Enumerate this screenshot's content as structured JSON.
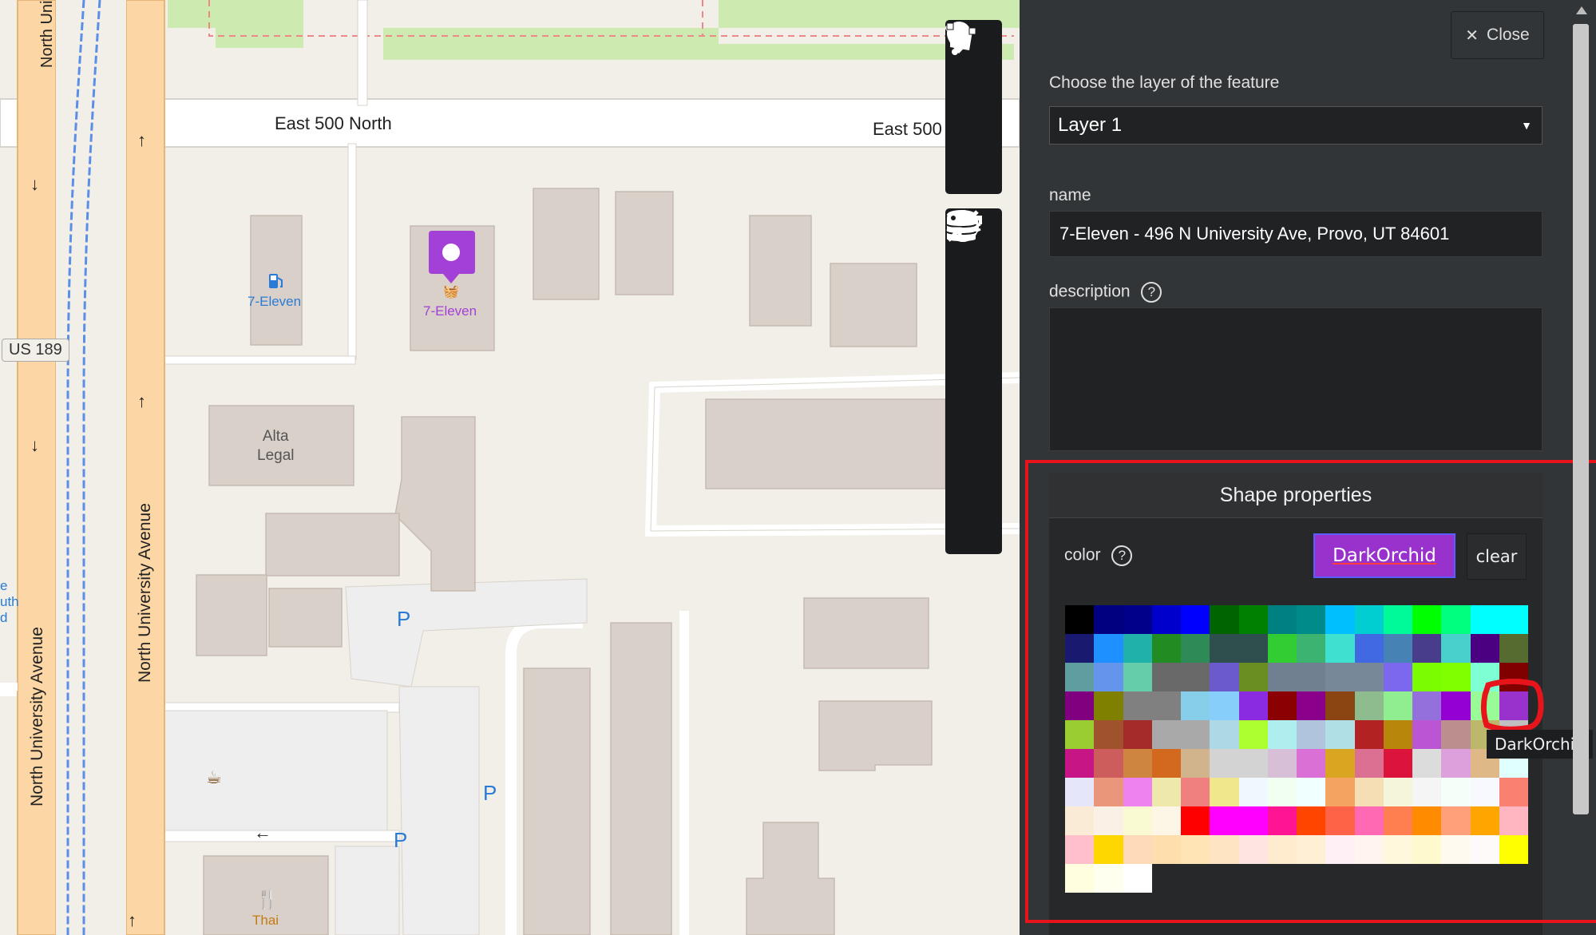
{
  "map": {
    "streets": {
      "east_500_north": "East 500 North",
      "east_500_right": "East 500",
      "north_univ_top": "North Unive",
      "north_univ_left": "North University Avenue",
      "north_univ_right": "North University Avenue",
      "us189": "US 189"
    },
    "pois": {
      "seven_eleven_1": "7-Eleven",
      "seven_eleven_2": "7-Eleven",
      "alta_legal": "Alta\nLegal",
      "thai": "Thai",
      "parking": "P",
      "side_text": "e\nuth\nd"
    },
    "marker_color": "#a340d8"
  },
  "toolbar": {
    "group1": [
      "marker-icon",
      "polyline-icon",
      "polygon-icon"
    ],
    "group2": [
      "upload-icon",
      "gear-icon",
      "layers-icon",
      "database-icon",
      "shrink-icon",
      "key-icon"
    ]
  },
  "panel": {
    "close_label": "Close",
    "layer_label": "Choose the layer of the feature",
    "layer_value": "Layer 1",
    "name_label": "name",
    "name_value": "7-Eleven - 496 N University Ave, Provo, UT 84601",
    "description_label": "description",
    "help_glyph": "?",
    "shape_title": "Shape properties",
    "color_label": "color",
    "color_value": "DarkOrchid",
    "color_hex": "#9932cc",
    "clear_label": "clear",
    "tooltip": "DarkOrchid",
    "palette": [
      "#000000",
      "#000080",
      "#00008b",
      "#0000cd",
      "#0000ff",
      "#006400",
      "#008000",
      "#008080",
      "#008b8b",
      "#00bfff",
      "#00ced1",
      "#00fa9a",
      "#00ff00",
      "#00ff7f",
      "#00ffff",
      "#00ffff",
      "#191970",
      "#1e90ff",
      "#20b2aa",
      "#228b22",
      "#2e8b57",
      "#2f4f4f",
      "#2f4f4f",
      "#32cd32",
      "#3cb371",
      "#40e0d0",
      "#4169e1",
      "#4682b4",
      "#483d8b",
      "#48d1cc",
      "#4b0082",
      "#556b2f",
      "#5f9ea0",
      "#6495ed",
      "#66cdaa",
      "#696969",
      "#696969",
      "#6a5acd",
      "#6b8e23",
      "#708090",
      "#708090",
      "#778899",
      "#778899",
      "#7b68ee",
      "#7cfc00",
      "#7fff00",
      "#7fffd4",
      "#800000",
      "#800080",
      "#808000",
      "#808080",
      "#808080",
      "#87ceeb",
      "#87cefa",
      "#8a2be2",
      "#8b0000",
      "#8b008b",
      "#8b4513",
      "#8fbc8f",
      "#90ee90",
      "#9370db",
      "#9400d3",
      "#98fb98",
      "#9932cc",
      "#9acd32",
      "#a0522d",
      "#a52a2a",
      "#a9a9a9",
      "#a9a9a9",
      "#add8e6",
      "#adff2f",
      "#afeeee",
      "#b0c4de",
      "#b0e0e6",
      "#b22222",
      "#b8860b",
      "#ba55d3",
      "#bc8f8f",
      "#bdb76b",
      "#c0c0c0",
      "#c71585",
      "#cd5c5c",
      "#cd853f",
      "#d2691e",
      "#d2b48c",
      "#d3d3d3",
      "#d3d3d3",
      "#d8bfd8",
      "#da70d6",
      "#daa520",
      "#db7093",
      "#dc143c",
      "#dcdcdc",
      "#dda0dd",
      "#deb887",
      "#e0ffff",
      "#e6e6fa",
      "#e9967a",
      "#ee82ee",
      "#eee8aa",
      "#f08080",
      "#f0e68c",
      "#f0f8ff",
      "#f0fff0",
      "#f0ffff",
      "#f4a460",
      "#f5deb3",
      "#f5f5dc",
      "#f5f5f5",
      "#f5fffa",
      "#f8f8ff",
      "#fa8072",
      "#faebd7",
      "#faf0e6",
      "#fafad2",
      "#fdf5e6",
      "#ff0000",
      "#ff00ff",
      "#ff00ff",
      "#ff1493",
      "#ff4500",
      "#ff6347",
      "#ff69b4",
      "#ff7f50",
      "#ff8c00",
      "#ffa07a",
      "#ffa500",
      "#ffb6c1",
      "#ffc0cb",
      "#ffd700",
      "#ffdab9",
      "#ffdead",
      "#ffe4b5",
      "#ffe4c4",
      "#ffe4e1",
      "#ffebcd",
      "#ffefd5",
      "#fff0f5",
      "#fff5ee",
      "#fff8dc",
      "#fffacd",
      "#fffaf0",
      "#fffafa",
      "#ffff00",
      "#ffffe0",
      "#fffff0",
      "#ffffff"
    ]
  }
}
